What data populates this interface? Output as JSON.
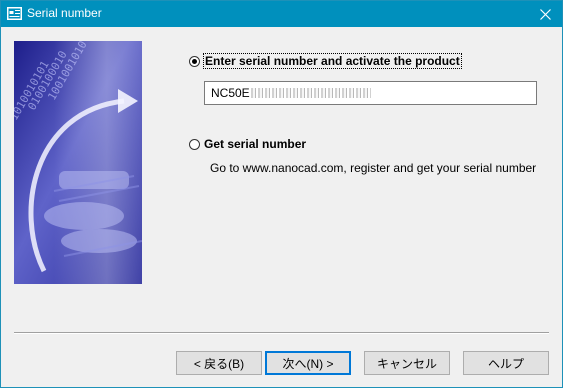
{
  "window": {
    "title": "Serial number",
    "icon": "serial-number-icon",
    "close_icon": "close-icon"
  },
  "options": {
    "activate": {
      "label": "Enter serial number and activate the product",
      "selected": true
    },
    "serial_field": {
      "value_visible": "NC50E"
    },
    "get_serial": {
      "label": "Get serial number",
      "selected": false,
      "hint": "Go to www.nanocad.com, register and get your serial number"
    }
  },
  "buttons": {
    "back": "< 戻る(B)",
    "next": "次へ(N) >",
    "cancel": "キャンセル",
    "help": "ヘルプ"
  },
  "colors": {
    "titlebar": "#0090bd",
    "accent": "#0078d7"
  }
}
